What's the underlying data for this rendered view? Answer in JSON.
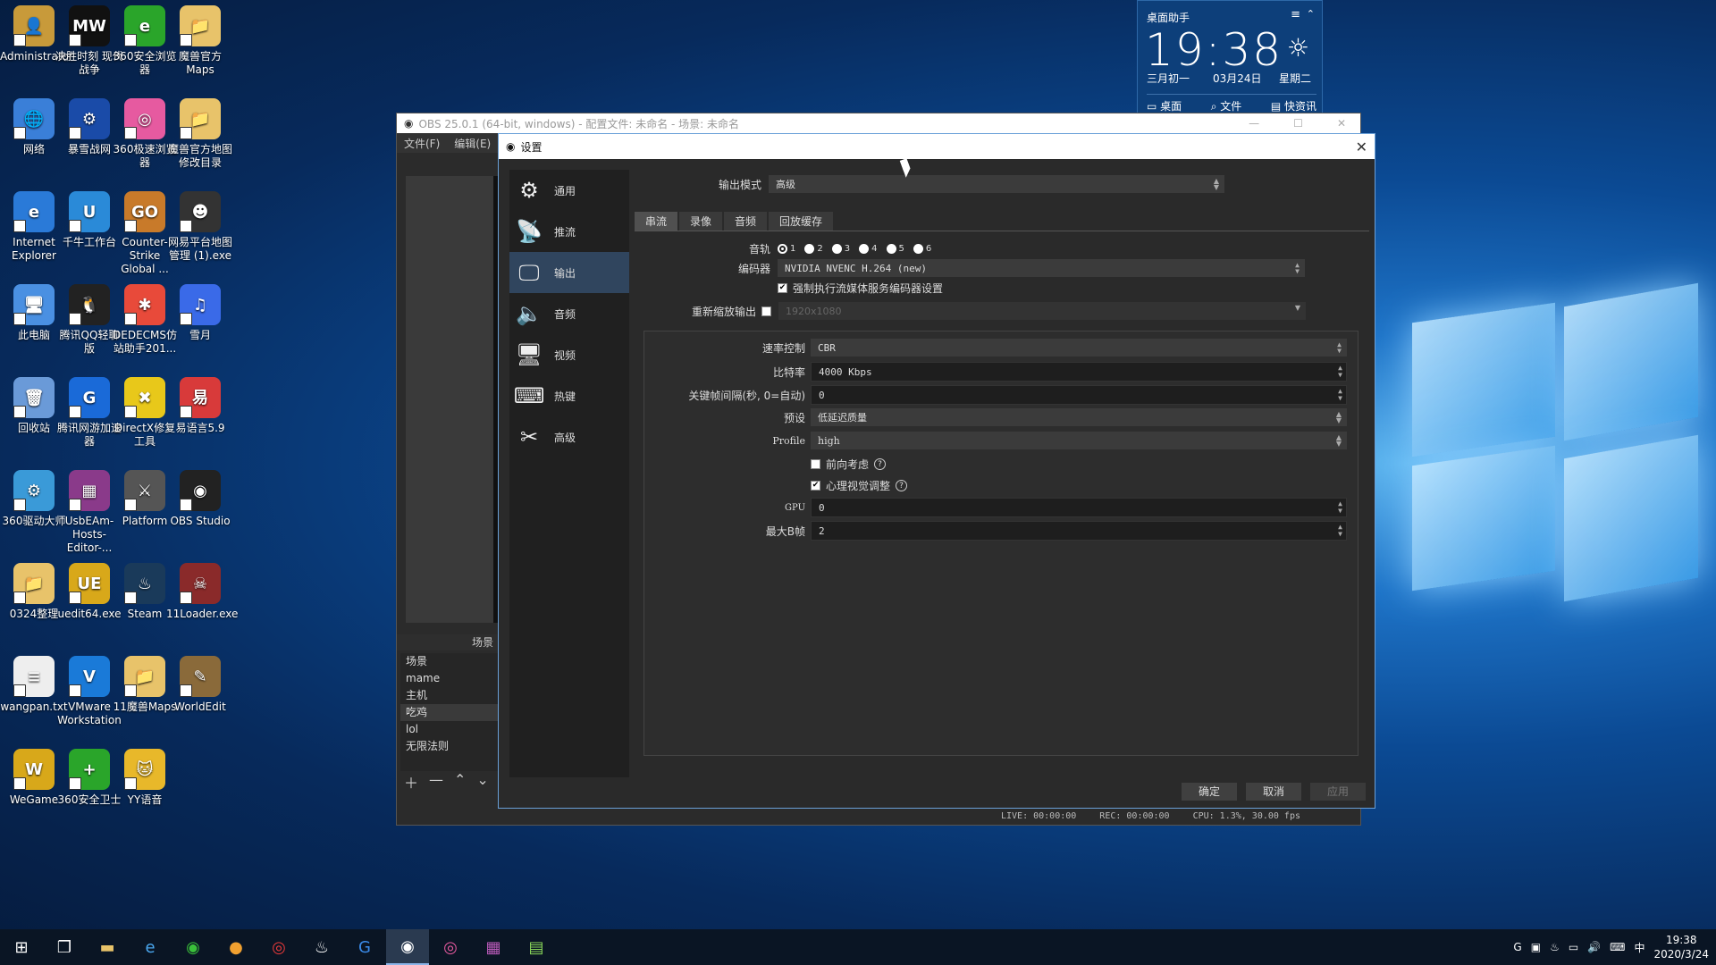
{
  "desktop": {
    "icons": [
      {
        "label": "Administrator",
        "color": "#c89a3a",
        "glyph": "👤"
      },
      {
        "label": "决胜时刻 现代战争",
        "color": "#111",
        "glyph": "MW"
      },
      {
        "label": "360安全浏览器",
        "color": "#2aa52a",
        "glyph": "e"
      },
      {
        "label": "魔兽官方 Maps",
        "color": "#e8c36a",
        "glyph": "📁"
      },
      {
        "label": "网络",
        "color": "#3a7fd8",
        "glyph": "🌐"
      },
      {
        "label": "暴雪战网",
        "color": "#1a4ba8",
        "glyph": "⚙"
      },
      {
        "label": "360极速浏览器",
        "color": "#e65aa0",
        "glyph": "◎"
      },
      {
        "label": "魔兽官方地图修改目录",
        "color": "#e8c36a",
        "glyph": "📁"
      },
      {
        "label": "Internet Explorer",
        "color": "#2a7ad8",
        "glyph": "e"
      },
      {
        "label": "千牛工作台",
        "color": "#2a8ad8",
        "glyph": "U"
      },
      {
        "label": "Counter-Strike Global ...",
        "color": "#c87a2a",
        "glyph": "GO"
      },
      {
        "label": "网易平台地图管理 (1).exe",
        "color": "#333",
        "glyph": "☻"
      },
      {
        "label": "此电脑",
        "color": "#4a90e2",
        "glyph": "🖥"
      },
      {
        "label": "腾讯QQ轻聊版",
        "color": "#222",
        "glyph": "🐧"
      },
      {
        "label": "DEDECMS仿站助手201...",
        "color": "#e84a3a",
        "glyph": "✱"
      },
      {
        "label": "雪月",
        "color": "#3a6ae8",
        "glyph": "♫"
      },
      {
        "label": "回收站",
        "color": "#6a9ad8",
        "glyph": "🗑"
      },
      {
        "label": "腾讯网游加速器",
        "color": "#1a6ad8",
        "glyph": "G"
      },
      {
        "label": "DirectX修复工具",
        "color": "#e8c81a",
        "glyph": "✖"
      },
      {
        "label": "易语言5.9",
        "color": "#d83a3a",
        "glyph": "易"
      },
      {
        "label": "360驱动大师",
        "color": "#3a9ad8",
        "glyph": "⚙"
      },
      {
        "label": "UsbEAm-Hosts-Editor-...",
        "color": "#8a3a8a",
        "glyph": "▦"
      },
      {
        "label": "Platform",
        "color": "#555",
        "glyph": "⚔"
      },
      {
        "label": "OBS Studio",
        "color": "#222",
        "glyph": "◉"
      },
      {
        "label": "0324整理",
        "color": "#e8c36a",
        "glyph": "📁"
      },
      {
        "label": "uedit64.exe",
        "color": "#d8a81a",
        "glyph": "UE"
      },
      {
        "label": "Steam",
        "color": "#1a3a5a",
        "glyph": "♨"
      },
      {
        "label": "11Loader.exe",
        "color": "#8a2a2a",
        "glyph": "☠"
      },
      {
        "label": "wangpan.txt",
        "color": "#eee",
        "glyph": "≡"
      },
      {
        "label": "VMware Workstation",
        "color": "#1a7ad8",
        "glyph": "V"
      },
      {
        "label": "11魔兽Maps",
        "color": "#e8c36a",
        "glyph": "📁"
      },
      {
        "label": "WorldEdit",
        "color": "#8a6a3a",
        "glyph": "✎"
      },
      {
        "label": "WeGame",
        "color": "#d8a81a",
        "glyph": "W"
      },
      {
        "label": "360安全卫士",
        "color": "#2aa52a",
        "glyph": "+"
      },
      {
        "label": "YY语音",
        "color": "#e8b82a",
        "glyph": "🐱"
      }
    ]
  },
  "widget": {
    "title": "桌面助手",
    "time": "19:38",
    "lunar": "三月初一",
    "date": "03月24日",
    "weekday": "星期二",
    "links": [
      "桌面",
      "文件",
      "快资讯"
    ]
  },
  "obs": {
    "title": "OBS 25.0.1 (64-bit, windows) - 配置文件: 未命名 - 场景: 未命名",
    "menu": [
      "文件(F)",
      "编辑(E)"
    ],
    "scenes_header": "场景",
    "scenes": [
      "场景",
      "mame",
      "主机",
      "吃鸡",
      "lol",
      "无限法则"
    ],
    "selected_scene": "吃鸡",
    "status": {
      "live": "LIVE: 00:00:00",
      "rec": "REC: 00:00:00",
      "cpu": "CPU: 1.3%, 30.00 fps"
    }
  },
  "settings": {
    "title": "设置",
    "close": "✕",
    "sidebar": [
      {
        "label": "通用",
        "icon": "gear-icon"
      },
      {
        "label": "推流",
        "icon": "broadcast-icon"
      },
      {
        "label": "输出",
        "icon": "output-icon"
      },
      {
        "label": "音频",
        "icon": "speaker-icon"
      },
      {
        "label": "视频",
        "icon": "monitor-icon"
      },
      {
        "label": "热键",
        "icon": "keyboard-icon"
      },
      {
        "label": "高级",
        "icon": "tools-icon"
      }
    ],
    "selected": "输出",
    "output_mode_label": "输出模式",
    "output_mode_value": "高级",
    "tabs": [
      "串流",
      "录像",
      "音频",
      "回放缓存"
    ],
    "selected_tab": "串流",
    "audio_track_label": "音轨",
    "tracks": [
      "1",
      "2",
      "3",
      "4",
      "5",
      "6"
    ],
    "selected_track": "1",
    "encoder_label": "编码器",
    "encoder_value": "NVIDIA NVENC H.264 (new)",
    "enforce_label": "强制执行流媒体服务编码器设置",
    "enforce_checked": true,
    "rescale_label": "重新缩放输出",
    "rescale_value": "1920x1080",
    "rate_control_label": "速率控制",
    "rate_control_value": "CBR",
    "bitrate_label": "比特率",
    "bitrate_value": "4000 Kbps",
    "keyframe_label": "关键帧间隔(秒, 0=自动)",
    "keyframe_value": "0",
    "preset_label": "预设",
    "preset_value": "低延迟质量",
    "profile_label": "Profile",
    "profile_value": "high",
    "lookahead_label": "前向考虑",
    "lookahead_checked": false,
    "psycho_label": "心理视觉调整",
    "psycho_checked": true,
    "gpu_label": "GPU",
    "gpu_value": "0",
    "bframes_label": "最大B帧",
    "bframes_value": "2",
    "ok": "确定",
    "cancel": "取消",
    "apply": "应用"
  },
  "tray": {
    "time": "19:38",
    "date": "2020/3/24",
    "ime": "中"
  },
  "colors": {
    "accent": "#30455e",
    "dialog_bg": "#2a2a2a"
  }
}
